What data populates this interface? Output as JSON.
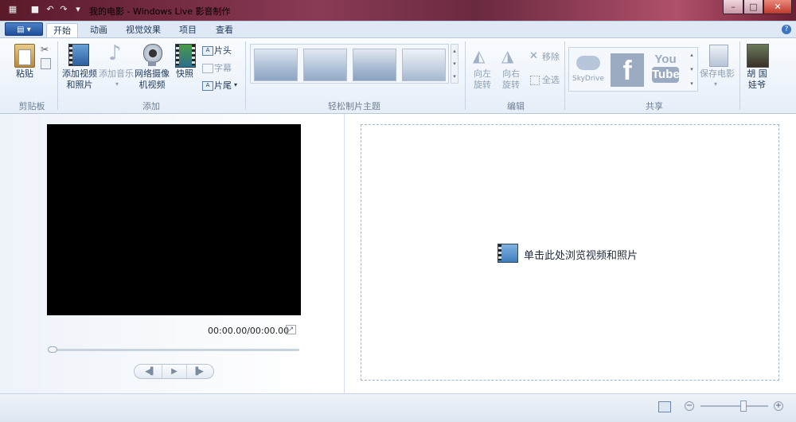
{
  "window": {
    "title": "我的电影 - Windows Live 影音制作",
    "controls": [
      "minimize-icon",
      "maximize-icon",
      "close-icon"
    ]
  },
  "tabs": [
    "开始",
    "动画",
    "视觉效果",
    "项目",
    "查看"
  ],
  "active_tab": "开始",
  "ribbon": {
    "clipboard": {
      "label": "剪贴板",
      "paste": "粘贴"
    },
    "add": {
      "label": "添加",
      "add_video": [
        "添加视频",
        "和照片"
      ],
      "add_music": "添加音乐",
      "webcam": [
        "网络摄像",
        "机视频"
      ],
      "snapshot": "快照",
      "title": "片头",
      "caption": "字幕",
      "credits": "片尾"
    },
    "themes": {
      "label": "轻松制片主题"
    },
    "edit": {
      "label": "编辑",
      "rotate_left": [
        "向左",
        "旋转"
      ],
      "rotate_right": [
        "向右",
        "旋转"
      ],
      "remove": "移除",
      "select_all": "全选"
    },
    "share": {
      "label": "共享",
      "skydrive": "SkyDrive",
      "facebook": "f",
      "youtube": [
        "You",
        "Tube"
      ],
      "save_movie": "保存电影"
    },
    "user": {
      "name": [
        "胡 国",
        "娃爷"
      ]
    }
  },
  "preview": {
    "time": "00:00.00/00:00.00"
  },
  "storyboard": {
    "browse_prompt": "单击此处浏览视频和照片"
  },
  "colors": {
    "accent": "#1e395b",
    "dropzone_border": "#9ab7dc"
  }
}
